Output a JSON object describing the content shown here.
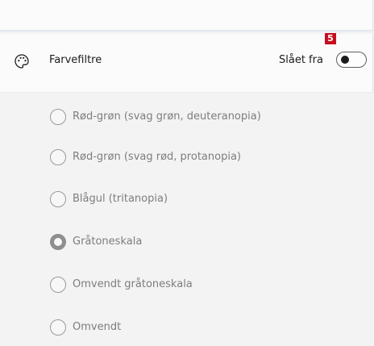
{
  "header": {
    "icon": "palette-icon",
    "label": "Farvefiltre",
    "status": "Slået fra",
    "toggle_on": false,
    "badge": "5"
  },
  "options": [
    {
      "label": "Rød-grøn (svag grøn, deuteranopia)",
      "selected": false
    },
    {
      "label": "Rød-grøn (svag rød, protanopia)",
      "selected": false
    },
    {
      "label": "Blågul (tritanopia)",
      "selected": false
    },
    {
      "label": "Gråtoneskala",
      "selected": true
    },
    {
      "label": "Omvendt gråtoneskala",
      "selected": false
    },
    {
      "label": "Omvendt",
      "selected": false
    }
  ],
  "colors": {
    "badge": "#c50f1f",
    "disabled_text": "#7d7d7d"
  }
}
